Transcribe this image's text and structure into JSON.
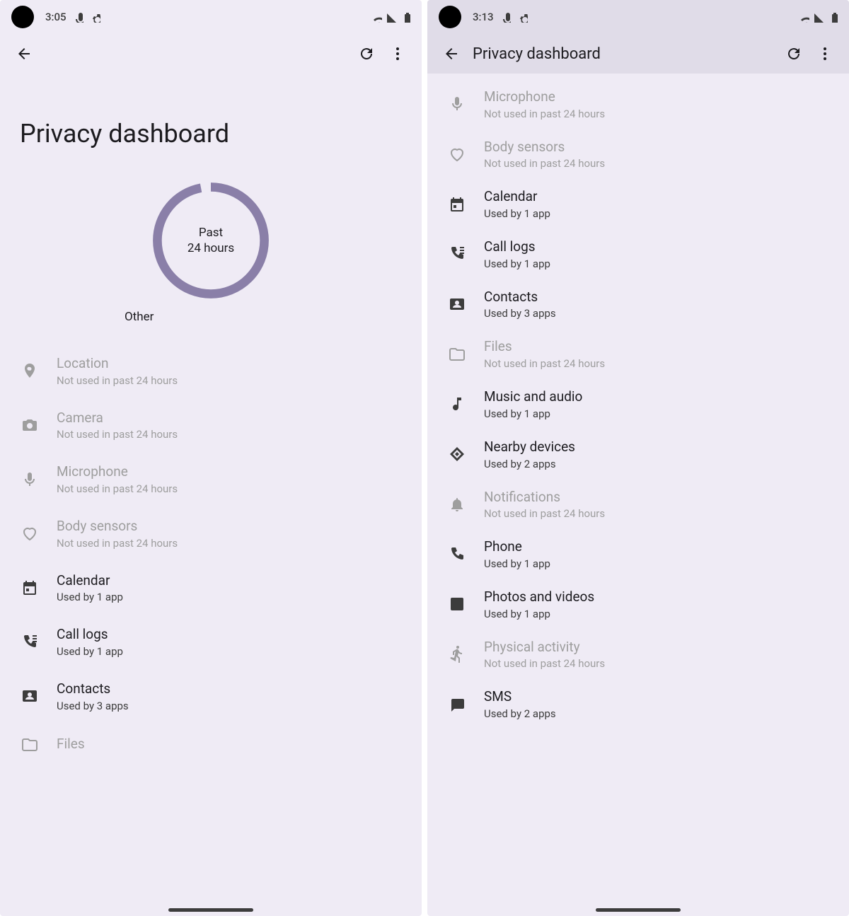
{
  "phone1": {
    "status": {
      "time": "3:05"
    },
    "page_title": "Privacy dashboard",
    "ring": {
      "line1": "Past",
      "line2": "24 hours",
      "legend": "Other"
    },
    "items": [
      {
        "icon": "location",
        "title": "Location",
        "sub": "Not used in past 24 hours",
        "dim": true
      },
      {
        "icon": "camera",
        "title": "Camera",
        "sub": "Not used in past 24 hours",
        "dim": true
      },
      {
        "icon": "mic",
        "title": "Microphone",
        "sub": "Not used in past 24 hours",
        "dim": true
      },
      {
        "icon": "heart",
        "title": "Body sensors",
        "sub": "Not used in past 24 hours",
        "dim": true
      },
      {
        "icon": "calendar",
        "title": "Calendar",
        "sub": "Used by 1 app",
        "dim": false
      },
      {
        "icon": "calllog",
        "title": "Call logs",
        "sub": "Used by 1 app",
        "dim": false
      },
      {
        "icon": "contacts",
        "title": "Contacts",
        "sub": "Used by 3 apps",
        "dim": false
      },
      {
        "icon": "files",
        "title": "Files",
        "sub": "",
        "dim": true
      }
    ]
  },
  "phone2": {
    "status": {
      "time": "3:13"
    },
    "app_bar_title": "Privacy dashboard",
    "items": [
      {
        "icon": "mic",
        "title": "Microphone",
        "sub": "Not used in past 24 hours",
        "dim": true
      },
      {
        "icon": "heart",
        "title": "Body sensors",
        "sub": "Not used in past 24 hours",
        "dim": true
      },
      {
        "icon": "calendar",
        "title": "Calendar",
        "sub": "Used by 1 app",
        "dim": false
      },
      {
        "icon": "calllog",
        "title": "Call logs",
        "sub": "Used by 1 app",
        "dim": false
      },
      {
        "icon": "contacts",
        "title": "Contacts",
        "sub": "Used by 3 apps",
        "dim": false
      },
      {
        "icon": "files",
        "title": "Files",
        "sub": "Not used in past 24 hours",
        "dim": true
      },
      {
        "icon": "music",
        "title": "Music and audio",
        "sub": "Used by 1 app",
        "dim": false
      },
      {
        "icon": "nearby",
        "title": "Nearby devices",
        "sub": "Used by 2 apps",
        "dim": false
      },
      {
        "icon": "bell",
        "title": "Notifications",
        "sub": "Not used in past 24 hours",
        "dim": true
      },
      {
        "icon": "phone",
        "title": "Phone",
        "sub": "Used by 1 app",
        "dim": false
      },
      {
        "icon": "image",
        "title": "Photos and videos",
        "sub": "Used by 1 app",
        "dim": false
      },
      {
        "icon": "run",
        "title": "Physical activity",
        "sub": "Not used in past 24 hours",
        "dim": true
      },
      {
        "icon": "sms",
        "title": "SMS",
        "sub": "Used by 2 apps",
        "dim": false
      }
    ]
  },
  "chart_data": {
    "type": "pie",
    "title": "Past 24 hours",
    "series": [
      {
        "name": "Other",
        "value": 97
      },
      {
        "name": "Gap",
        "value": 3
      }
    ],
    "colors": {
      "Other": "#8a7fa8",
      "Gap": "transparent"
    }
  }
}
